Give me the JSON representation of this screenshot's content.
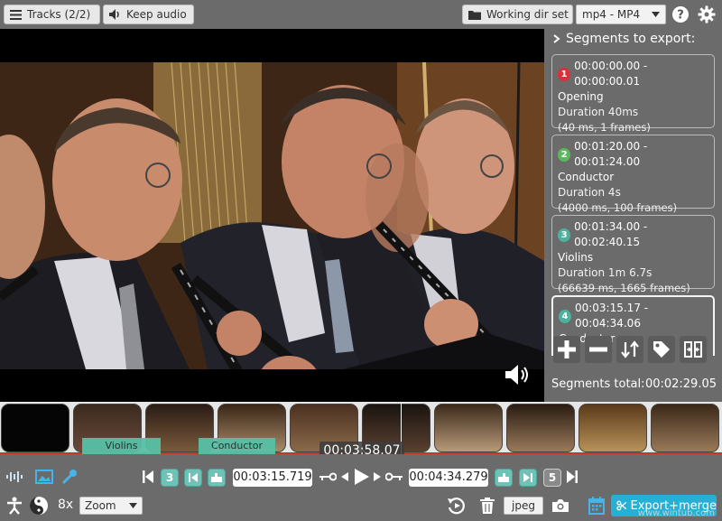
{
  "topbar": {
    "tracks_label": "Tracks (2/2)",
    "keep_audio_label": "Keep audio",
    "working_dir_label": "Working dir set",
    "format_value": "mp4 - MP4"
  },
  "panel": {
    "title": "Segments to export:",
    "segments": [
      {
        "number": "1",
        "range": "00:00:00.00 - 00:00:00.01",
        "name": "Opening",
        "duration": "Duration 40ms",
        "detail": "(40 ms, 1 frames)",
        "color": "#d9303a"
      },
      {
        "number": "2",
        "range": "00:01:20.00 - 00:01:24.00",
        "name": "Conductor",
        "duration": "Duration 4s",
        "detail": "(4000 ms, 100 frames)",
        "color": "#5cb85c"
      },
      {
        "number": "3",
        "range": "00:01:34.00 - 00:02:40.15",
        "name": "Violins",
        "duration": "Duration 1m 6.7s",
        "detail": "(66639 ms, 1665 frames)",
        "color": "#4db29c"
      },
      {
        "number": "4",
        "range": "00:03:15.17 - 00:04:34.06",
        "name": "Conductor",
        "duration": "",
        "detail": "",
        "color": "#4db29c"
      }
    ],
    "total_label": "Segments total:",
    "total_value": "00:02:29.05"
  },
  "timeline": {
    "band_violins": "Violins",
    "band_conductor": "Conductor",
    "current_time": "00:03:58.07"
  },
  "controls": {
    "seg_index_start": "3",
    "start_time": "00:03:15.719",
    "end_time": "00:04:34.279",
    "seg_index_end": "5",
    "zoom_level": "8x",
    "zoom_select": "Zoom",
    "capture_format": "jpeg",
    "export_label": "Export+merge"
  },
  "watermark": "www.wintub.com"
}
